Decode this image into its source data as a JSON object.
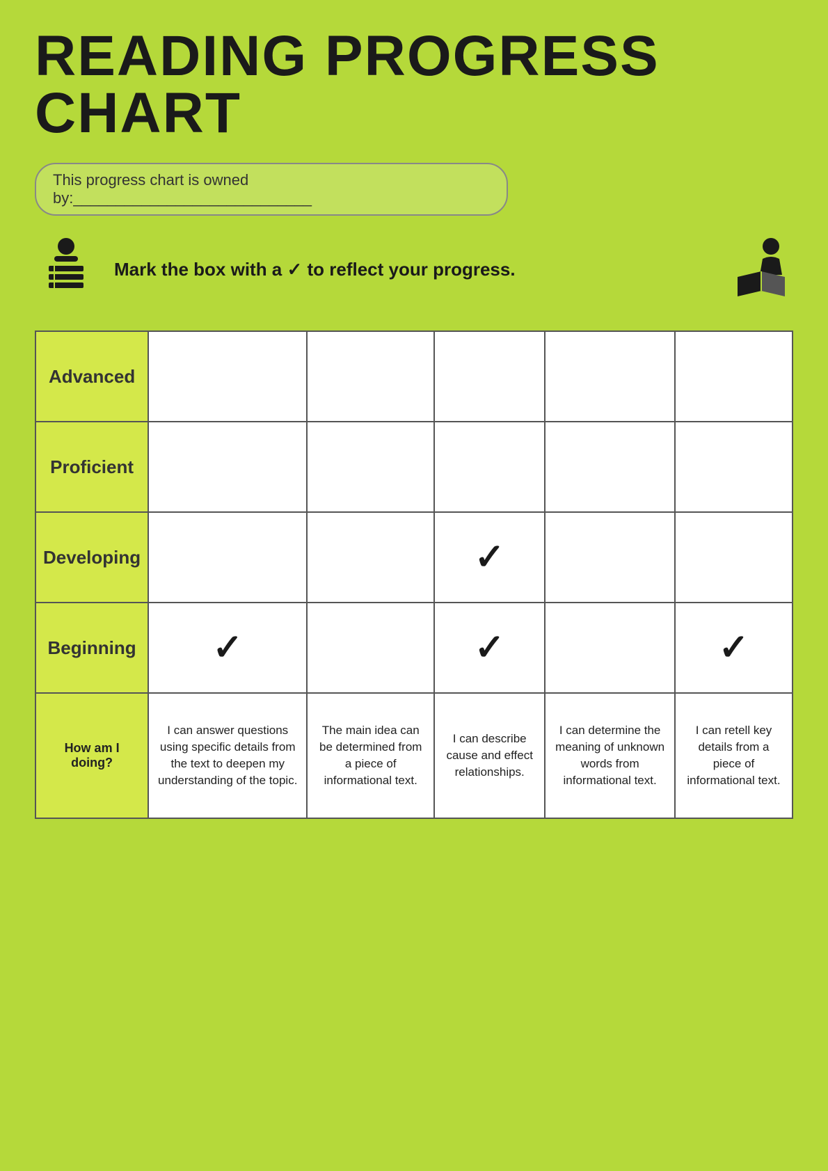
{
  "title": "READING PROGRESS CHART",
  "owner_label": "This progress chart is owned by:____________________________",
  "instructions": "Mark the box with a ✓ to reflect your progress.",
  "rows": [
    {
      "label": "Advanced",
      "checks": [
        false,
        false,
        false,
        false,
        false
      ]
    },
    {
      "label": "Proficient",
      "checks": [
        false,
        false,
        false,
        false,
        false
      ]
    },
    {
      "label": "Developing",
      "checks": [
        false,
        false,
        true,
        false,
        false
      ]
    },
    {
      "label": "Beginning",
      "checks": [
        true,
        false,
        true,
        false,
        true
      ]
    }
  ],
  "how_label": "How am I doing?",
  "skill_descriptions": [
    "I can answer questions using specific details from the text to deepen my understanding of the topic.",
    "The main idea can be determined from a piece of informational text.",
    "I can describe cause and effect relationships.",
    "I can determine the meaning of unknown words from informational text.",
    "I can retell key details from a piece of informational text."
  ]
}
